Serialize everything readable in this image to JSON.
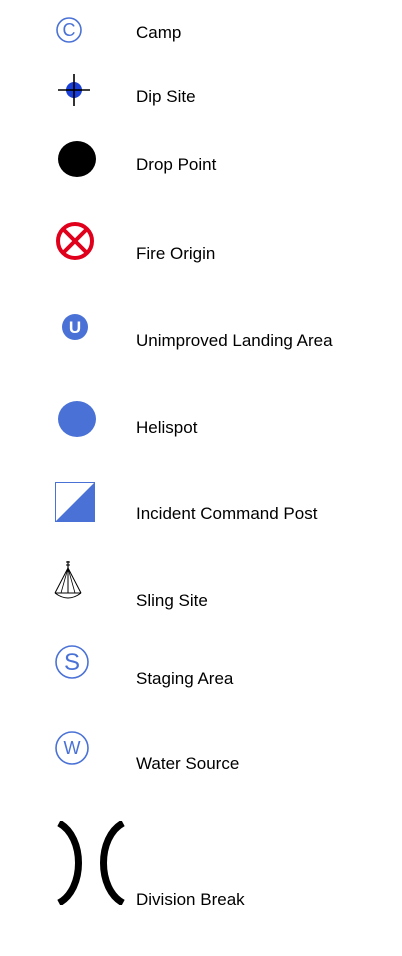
{
  "legend": {
    "items": [
      {
        "label": "Camp",
        "icon": "camp-icon"
      },
      {
        "label": "Dip Site",
        "icon": "dip-site-icon"
      },
      {
        "label": "Drop Point",
        "icon": "drop-point-icon"
      },
      {
        "label": "Fire Origin",
        "icon": "fire-origin-icon"
      },
      {
        "label": "Unimproved Landing Area",
        "icon": "unimproved-landing-area-icon"
      },
      {
        "label": "Helispot",
        "icon": "helispot-icon"
      },
      {
        "label": "Incident Command Post",
        "icon": "incident-command-post-icon"
      },
      {
        "label": "Sling Site",
        "icon": "sling-site-icon"
      },
      {
        "label": "Staging Area",
        "icon": "staging-area-icon"
      },
      {
        "label": "Water Source",
        "icon": "water-source-icon"
      },
      {
        "label": "Division Break",
        "icon": "division-break-icon"
      }
    ],
    "glyphs": {
      "camp": "C",
      "unimproved": "U",
      "staging": "S",
      "water": "W"
    },
    "colors": {
      "blue": "#4a72d6",
      "red": "#e0001b",
      "black": "#000000"
    }
  }
}
